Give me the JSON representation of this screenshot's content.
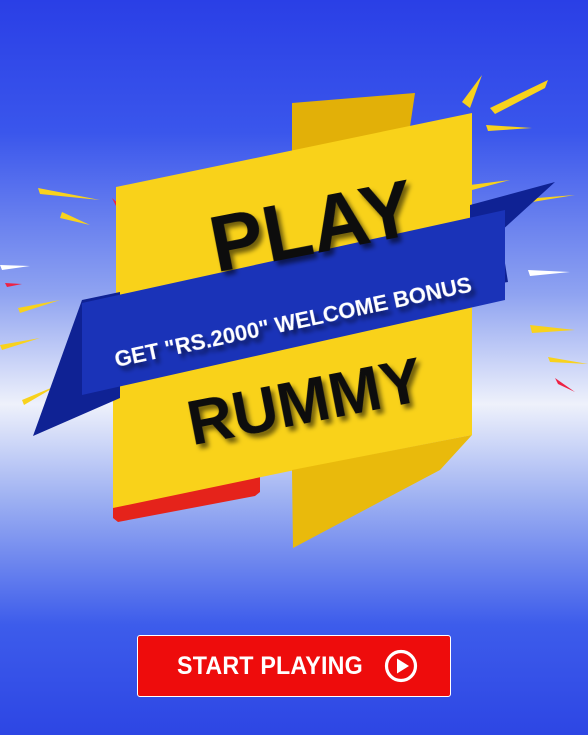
{
  "banner": {
    "title_top": "PLAY",
    "title_bottom": "RUMMY",
    "ribbon_text": "GET \"RS.2000\" WELCOME BONUS"
  },
  "cta": {
    "label": "START PLAYING",
    "icon": "play-circle-icon"
  },
  "colors": {
    "background": "#3a56ec",
    "banner_yellow": "#f9d21a",
    "ribbon_blue": "#1a33b8",
    "accent_red": "#ee0c0c",
    "text_dark": "#111111",
    "text_light": "#ffffff"
  }
}
